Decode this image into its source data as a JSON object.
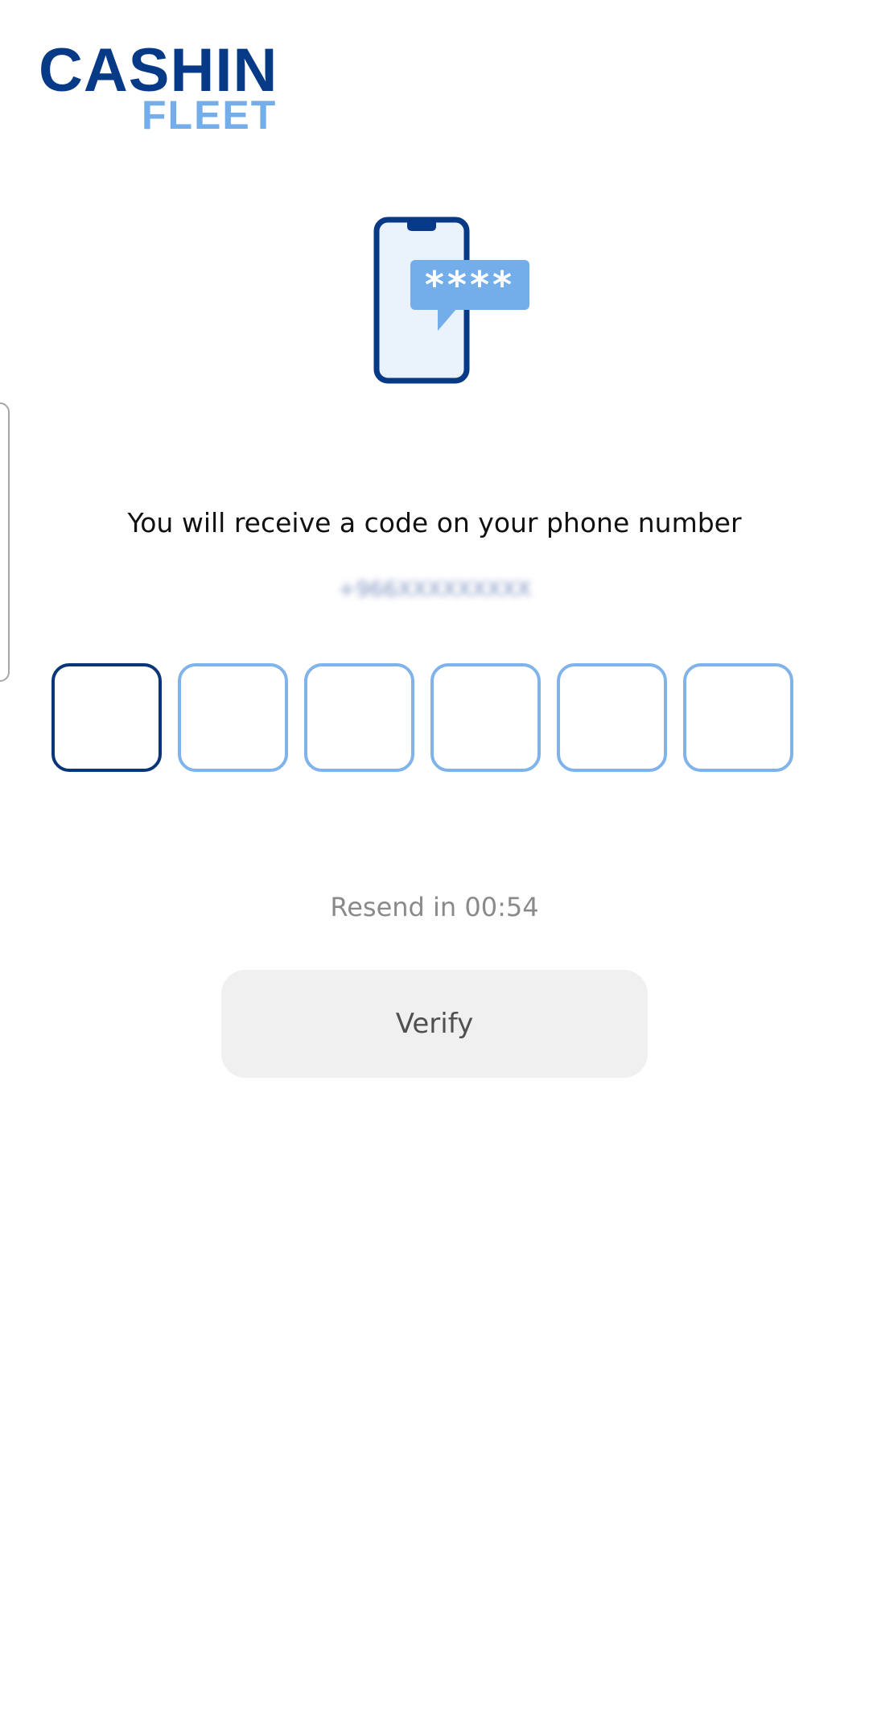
{
  "brand": {
    "name": "CASHIN",
    "sub": "FLEET",
    "primary_color": "#073a86",
    "secondary_color": "#74aeea"
  },
  "illustration": {
    "icon": "phone-message-icon",
    "code_mask": "****"
  },
  "message": "You will receive a code on your phone number",
  "phone_number": "+966XXXXXXXXX",
  "otp": {
    "length": 6,
    "values": [
      "",
      "",
      "",
      "",
      "",
      ""
    ],
    "active_index": 0
  },
  "resend": "Resend in 00:54",
  "verify_label": "Verify"
}
